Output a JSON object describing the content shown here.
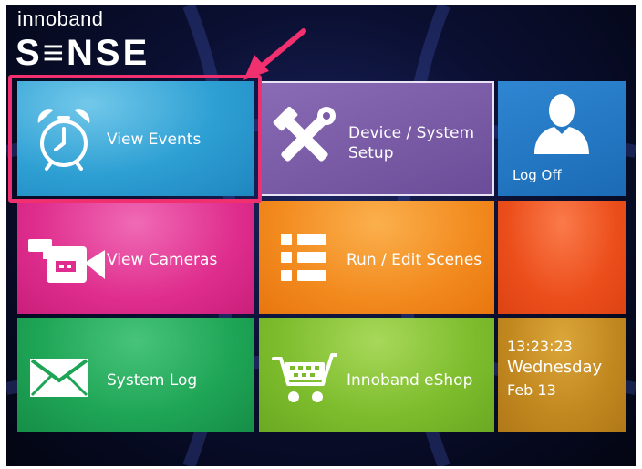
{
  "brand": {
    "top": "innoband",
    "main": "S≡NSE"
  },
  "tiles": {
    "view_events": "View Events",
    "device_setup_line1": "Device / System",
    "device_setup_line2": "Setup",
    "log_off": "Log Off",
    "view_cameras": "View Cameras",
    "run_edit_scenes": "Run / Edit Scenes",
    "system_log": "System Log",
    "eshop": "Innoband eShop"
  },
  "clock": {
    "time": "13:23:23",
    "weekday": "Wednesday",
    "date": "Feb 13"
  },
  "icons": {
    "view_events": "alarm-clock-icon",
    "device_setup": "hammer-wrench-icon",
    "log_off": "user-icon",
    "view_cameras": "video-camera-icon",
    "run_edit_scenes": "list-icon",
    "system_log": "envelope-icon",
    "eshop": "shopping-cart-icon"
  },
  "colors": {
    "view_events": "#2d9fd3",
    "device_setup": "#6a4c98",
    "log_off": "#1b6bb6",
    "view_cameras": "#df2d8d",
    "run_edit_scenes": "#f28a1e",
    "extra_tile": "#eb4e1b",
    "system_log": "#1ea455",
    "eshop": "#7cbc2c",
    "clock": "#c1871f",
    "highlight": "#f0306f"
  }
}
